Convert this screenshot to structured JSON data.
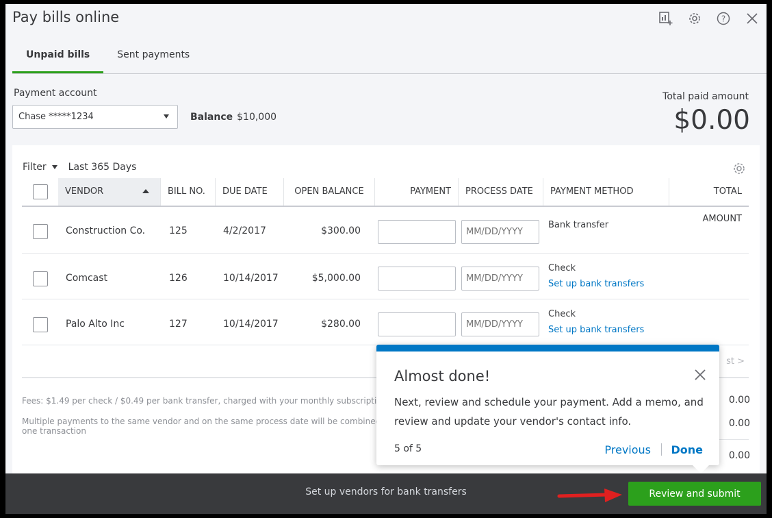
{
  "window": {
    "title": "Pay bills online",
    "icons": [
      "report-add-icon",
      "gear-icon",
      "help-icon",
      "close-icon"
    ]
  },
  "tabs": [
    {
      "label": "Unpaid bills",
      "active": true
    },
    {
      "label": "Sent payments",
      "active": false
    }
  ],
  "account": {
    "label": "Payment account",
    "selected": "Chase *****1234",
    "balance_label": "Balance",
    "balance_value": "$10,000"
  },
  "total": {
    "label": "Total paid amount",
    "value": "$0.00"
  },
  "filter": {
    "label": "Filter",
    "range": "Last 365 Days"
  },
  "table": {
    "columns": [
      "VENDOR",
      "BILL NO.",
      "DUE DATE",
      "OPEN BALANCE",
      "PAYMENT",
      "PROCESS DATE",
      "PAYMENT METHOD",
      "TOTAL AMOUNT"
    ],
    "date_placeholder": "MM/DD/YYYY",
    "rows": [
      {
        "vendor": "Construction Co.",
        "bill_no": "125",
        "due_date": "4/2/2017",
        "open_balance": "$300.00",
        "method": "Bank transfer",
        "link": ""
      },
      {
        "vendor": "Comcast",
        "bill_no": "126",
        "due_date": "10/14/2017",
        "open_balance": "$5,000.00",
        "method": "Check",
        "link": "Set up bank transfers"
      },
      {
        "vendor": "Palo Alto Inc",
        "bill_no": "127",
        "due_date": "10/14/2017",
        "open_balance": "$280.00",
        "method": "Check",
        "link": "Set up bank transfers"
      }
    ]
  },
  "pager": "st >",
  "notes": {
    "fees": "Fees: $1.49 per check / $0.49 per bank transfer, charged with your monthly subscriptic",
    "multiple_line1": "Multiple payments to the same vendor and on the same process date will be combinec",
    "multiple_line2": "one transaction"
  },
  "summary": [
    "0.00",
    "0.00",
    "0.00"
  ],
  "popover": {
    "title": "Almost done!",
    "body": "Next, review and schedule your payment. Add a memo, and review and update your vendor's contact info.",
    "step": "5 of 5",
    "previous": "Previous",
    "done": "Done"
  },
  "footer": {
    "text": "Set up vendors for bank transfers",
    "submit": "Review and submit"
  },
  "colors": {
    "accent_green": "#2ca01c",
    "link_blue": "#0077c5",
    "footer_bg": "#393a3d",
    "arrow_red": "#e02020"
  }
}
